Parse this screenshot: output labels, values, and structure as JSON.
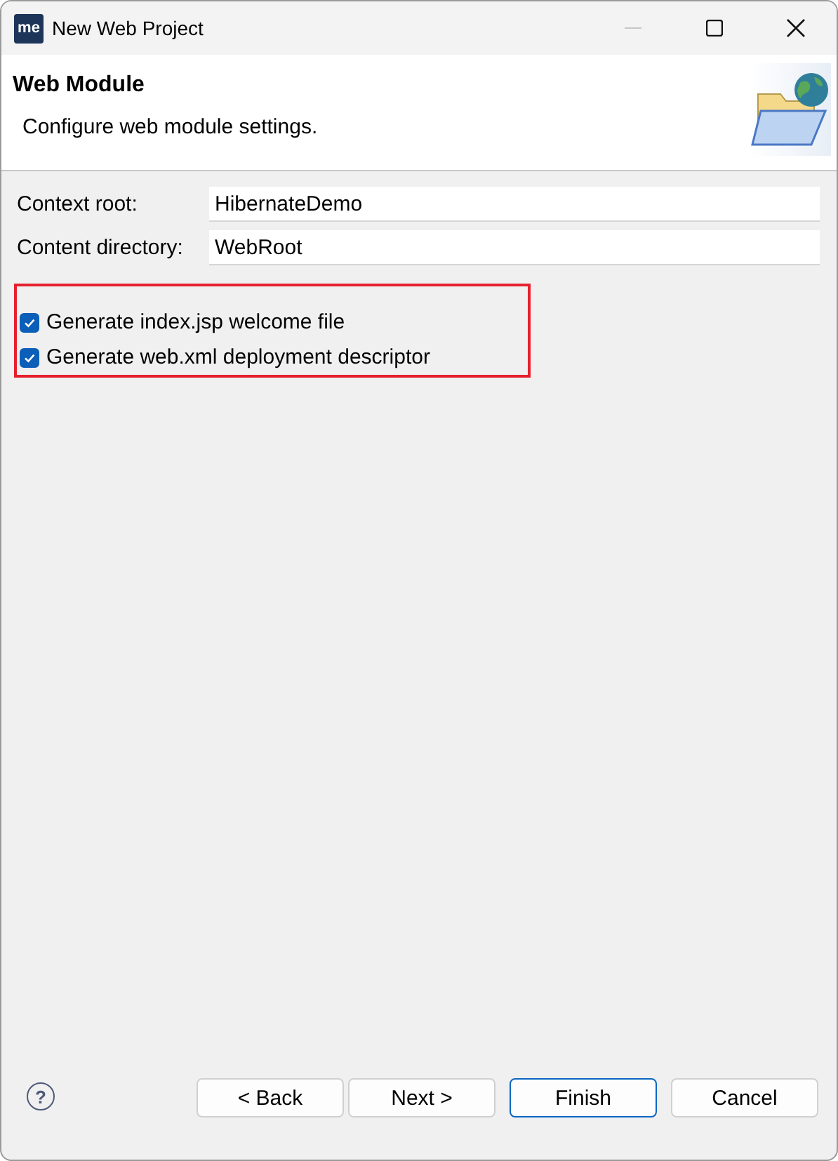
{
  "window": {
    "app_icon": "me",
    "title": "New Web Project",
    "controls": [
      {
        "kind": "minimize",
        "disabled": true
      },
      {
        "kind": "maximize",
        "disabled": false
      },
      {
        "kind": "close",
        "disabled": false
      }
    ]
  },
  "header": {
    "title": "Web Module",
    "description": "Configure web module settings."
  },
  "fields": [
    {
      "label": "Context root:",
      "value": "HibernateDemo"
    },
    {
      "label": "Content directory:",
      "value": "WebRoot"
    }
  ],
  "checkboxes": [
    {
      "label": "Generate index.jsp welcome file",
      "checked": true
    },
    {
      "label": "Generate web.xml deployment descriptor",
      "checked": true
    }
  ],
  "help": "?",
  "buttons": [
    {
      "label": "< Back",
      "default": false
    },
    {
      "label": "Next >",
      "default": false
    },
    {
      "label": "Finish",
      "default": true
    },
    {
      "label": "Cancel",
      "default": false
    }
  ]
}
